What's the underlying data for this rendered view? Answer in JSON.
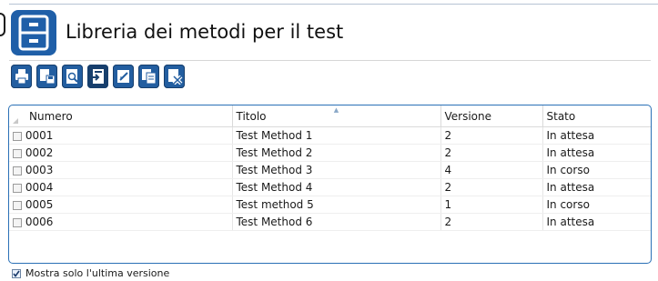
{
  "header": {
    "title": "Libreria dei metodi per il test",
    "icon": "file-cabinet-icon",
    "icon_color": "#1f5fa8"
  },
  "toolbar": {
    "buttons": [
      {
        "name": "print-icon"
      },
      {
        "name": "save-icon"
      },
      {
        "name": "preview-icon"
      },
      {
        "name": "import-icon"
      },
      {
        "name": "edit-icon"
      },
      {
        "name": "copy-icon"
      },
      {
        "name": "delete-icon"
      }
    ],
    "accent": "#235ea0"
  },
  "table": {
    "columns": [
      "Numero",
      "Titolo",
      "Versione",
      "Stato"
    ],
    "sorted_column": "Titolo",
    "rows": [
      {
        "numero": "0001",
        "titolo": "Test Method 1",
        "versione": "2",
        "stato": "In attesa"
      },
      {
        "numero": "0002",
        "titolo": "Test Method 2",
        "versione": "2",
        "stato": "In attesa"
      },
      {
        "numero": "0003",
        "titolo": "Test Method 3",
        "versione": "4",
        "stato": "In corso"
      },
      {
        "numero": "0004",
        "titolo": "Test Method 4",
        "versione": "2",
        "stato": "In attesa"
      },
      {
        "numero": "0005",
        "titolo": "Test method 5",
        "versione": "1",
        "stato": "In corso"
      },
      {
        "numero": "0006",
        "titolo": "Test Method 6",
        "versione": "2",
        "stato": "In attesa"
      }
    ]
  },
  "footer": {
    "checkbox_label": "Mostra solo l'ultima versione",
    "checked": true
  }
}
